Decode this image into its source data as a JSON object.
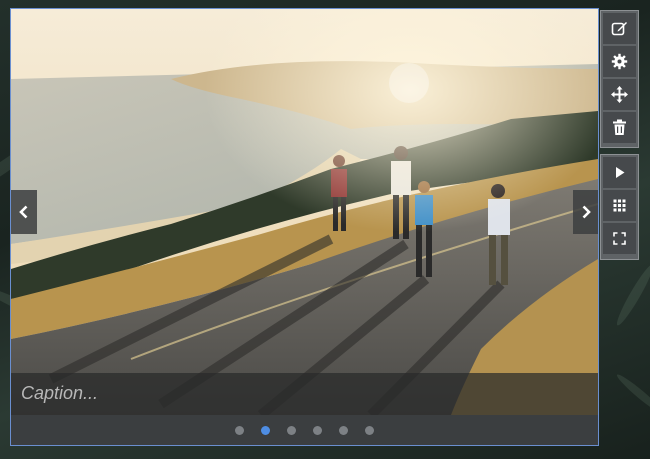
{
  "slider": {
    "caption_placeholder": "Caption...",
    "slide_count": 6,
    "active_slide_index": 1,
    "image_description_icon": "landscape-photo"
  },
  "toolbar_top": {
    "buttons": [
      "edit-icon",
      "gear-icon",
      "move-icon",
      "trash-icon"
    ]
  },
  "toolbar_bottom": {
    "buttons": [
      "play-icon",
      "grid-icon",
      "fullscreen-icon"
    ]
  },
  "colors": {
    "active_dot": "#4e8de3",
    "inactive_dot": "#7d8185",
    "slider_border": "#6a8fd0",
    "toolbar_bg": "#5f6366"
  }
}
